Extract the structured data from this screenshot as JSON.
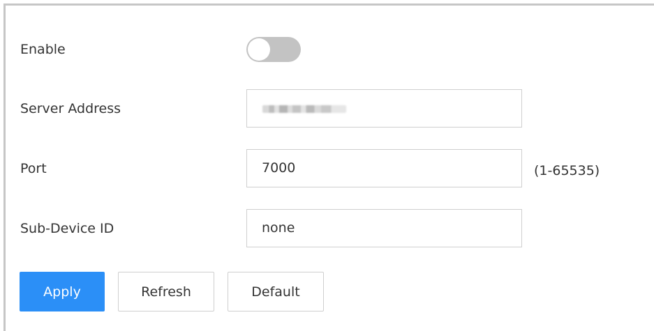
{
  "form": {
    "enable": {
      "label": "Enable",
      "toggle_on": false
    },
    "server_address": {
      "label": "Server Address",
      "value": "",
      "value_obscured": true
    },
    "port": {
      "label": "Port",
      "value": "7000",
      "range_hint": "(1-65535)"
    },
    "sub_device_id": {
      "label": "Sub-Device ID",
      "value": "none"
    }
  },
  "actions": {
    "apply_label": "Apply",
    "refresh_label": "Refresh",
    "default_label": "Default"
  },
  "colors": {
    "primary": "#2b8ff7",
    "toggle_off": "#c3c3c3",
    "border": "#cfcfcf",
    "text": "#333333"
  }
}
